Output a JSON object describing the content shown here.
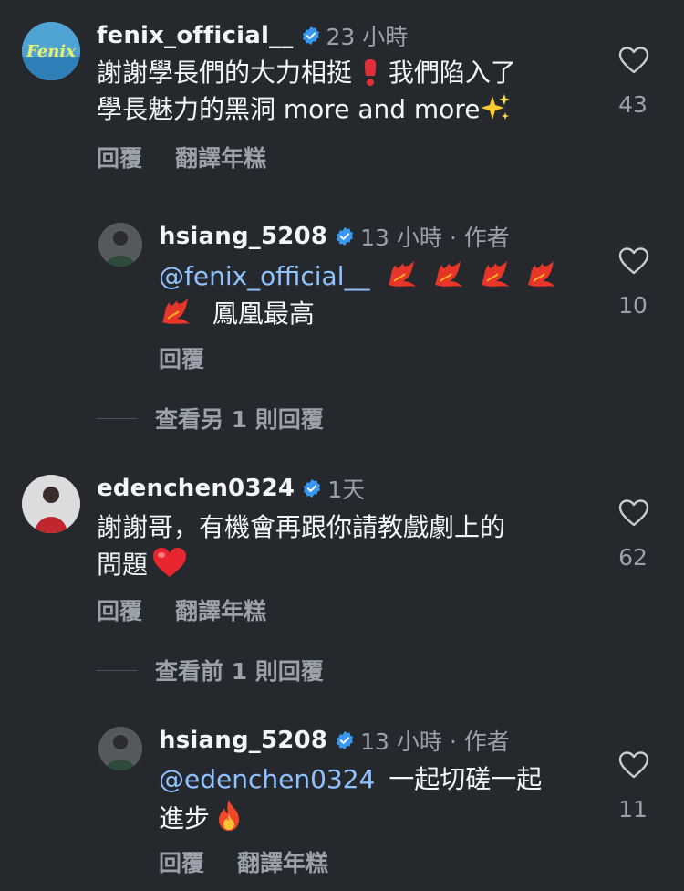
{
  "comments": [
    {
      "username": "fenix_official__",
      "time": "23 小時",
      "text_line1": "謝謝學長們的大力相挺",
      "text_line1b": "我們陷入了",
      "text_line2": "學長魅力的黑洞 more and more",
      "reply": "回覆",
      "translate": "翻譯年糕",
      "likes": "43"
    },
    {
      "username": "hsiang_5208",
      "time": "13 小時 · 作者",
      "mention": "@fenix_official__",
      "text_line2": "鳳凰最高",
      "reply": "回覆",
      "likes": "10"
    },
    {
      "view_more": "查看另 1 則回覆"
    },
    {
      "username": "edenchen0324",
      "time": "1天",
      "text_line1": "謝謝哥，有機會再跟你請教戲劇上的",
      "text_line2": "問題",
      "reply": "回覆",
      "translate": "翻譯年糕",
      "likes": "62"
    },
    {
      "view_more": "查看前 1 則回覆"
    },
    {
      "username": "hsiang_5208",
      "time": "13 小時 · 作者",
      "mention": "@edenchen0324",
      "text_line1b": "一起切磋一起",
      "text_line2": "進步",
      "reply": "回覆",
      "translate": "翻譯年糕",
      "likes": "11"
    }
  ],
  "colors": {
    "background": "#25292e",
    "mention": "#8fc2ff",
    "verified": "#3897f0",
    "meta": "#9aa1aa"
  },
  "icons": {
    "verified": "verified-badge-icon",
    "like": "heart-outline-icon",
    "emoji_heart_exclamation": "red-exclamation-icon",
    "emoji_sparkles": "sparkles-icon",
    "emoji_phoenix": "phoenix-icon",
    "emoji_red_heart": "red-heart-icon",
    "emoji_fire": "fire-icon"
  }
}
